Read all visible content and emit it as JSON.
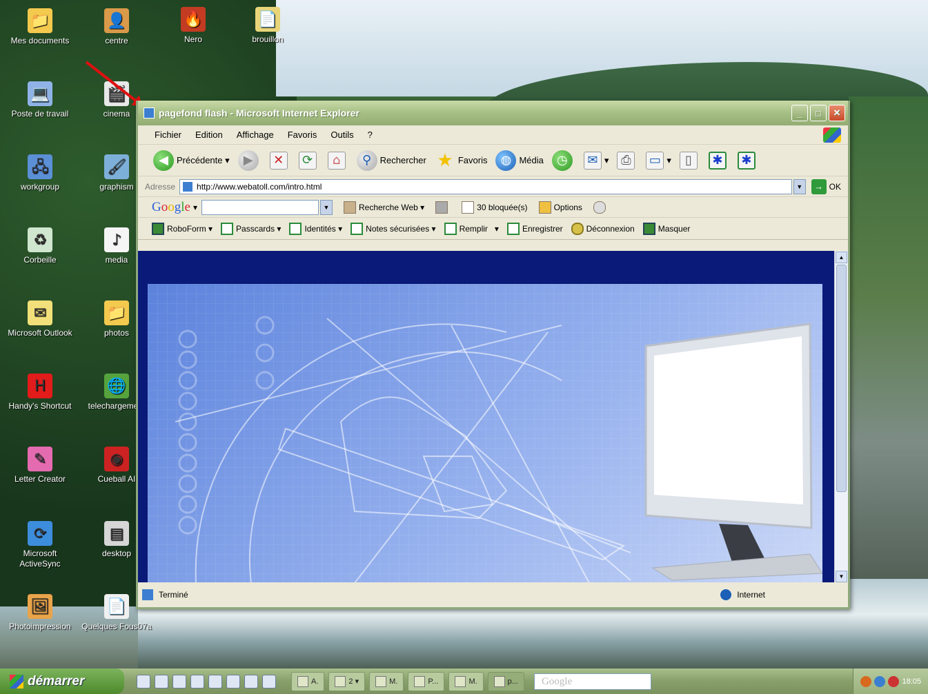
{
  "desktop": {
    "icons": [
      {
        "label": "Mes documents",
        "glyph": "📁",
        "color": "#f3c94e"
      },
      {
        "label": "centre",
        "glyph": "👤",
        "color": "#d99a4a"
      },
      {
        "label": "Nero",
        "glyph": "🔥",
        "color": "#c23b22"
      },
      {
        "label": "brouillon",
        "glyph": "📄",
        "color": "#e8d57a"
      },
      {
        "label": "Poste de travail",
        "glyph": "💻",
        "color": "#8fb3e6"
      },
      {
        "label": "cinema",
        "glyph": "🎬",
        "color": "#e8e8e8"
      },
      {
        "label": "workgroup",
        "glyph": "🖧",
        "color": "#5b8fd6"
      },
      {
        "label": "graphism",
        "glyph": "🖌",
        "color": "#7db0d9"
      },
      {
        "label": "Corbeille",
        "glyph": "♻",
        "color": "#cfe6cf"
      },
      {
        "label": "media",
        "glyph": "♪",
        "color": "#f5f5f5"
      },
      {
        "label": "Microsoft Outlook",
        "glyph": "✉",
        "color": "#f1e07a"
      },
      {
        "label": "photos",
        "glyph": "📁",
        "color": "#f3c94e"
      },
      {
        "label": "Handy's Shortcut",
        "glyph": "H",
        "color": "#e21b1b"
      },
      {
        "label": "telechargement",
        "glyph": "🌐",
        "color": "#56a33e"
      },
      {
        "label": "Letter Creator",
        "glyph": "✎",
        "color": "#e56bb0"
      },
      {
        "label": "Cueball AI",
        "glyph": "◉",
        "color": "#c22"
      },
      {
        "label": "Microsoft ActiveSync",
        "glyph": "⟳",
        "color": "#3d8ddd"
      },
      {
        "label": "desktop",
        "glyph": "▤",
        "color": "#d6d6d6"
      },
      {
        "label": "Photoimpression",
        "glyph": "🖼",
        "color": "#e9a44a"
      },
      {
        "label": "Quelques Fous07a",
        "glyph": "📄",
        "color": "#f0f0f0"
      }
    ]
  },
  "window": {
    "title": "pagefond flash - Microsoft Internet Explorer",
    "menu": [
      "Fichier",
      "Edition",
      "Affichage",
      "Favoris",
      "Outils",
      "?"
    ],
    "toolbar": {
      "back": "Précédente",
      "search": "Rechercher",
      "favorites": "Favoris",
      "media": "Média"
    },
    "address": {
      "label": "Adresse",
      "url": "http://www.webatoll.com/intro.html",
      "go": "OK"
    },
    "google": {
      "logo_parts": [
        "G",
        "o",
        "o",
        "g",
        "l",
        "e"
      ],
      "search_web": "Recherche Web",
      "blocked": "30 bloquée(s)",
      "options": "Options"
    },
    "links": {
      "roboform": "RoboForm",
      "passcards": "Passcards",
      "identities": "Identités",
      "notes": "Notes sécurisées",
      "fill": "Remplir",
      "save": "Enregistrer",
      "logoff": "Déconnexion",
      "hide": "Masquer"
    },
    "status": {
      "text": "Terminé",
      "zone": "Internet"
    }
  },
  "taskbar": {
    "start": "démarrer",
    "tasks": [
      "A.",
      "2",
      "M.",
      "P...",
      "M.",
      "p..."
    ],
    "google_placeholder": "Google",
    "clock": "18:05"
  }
}
